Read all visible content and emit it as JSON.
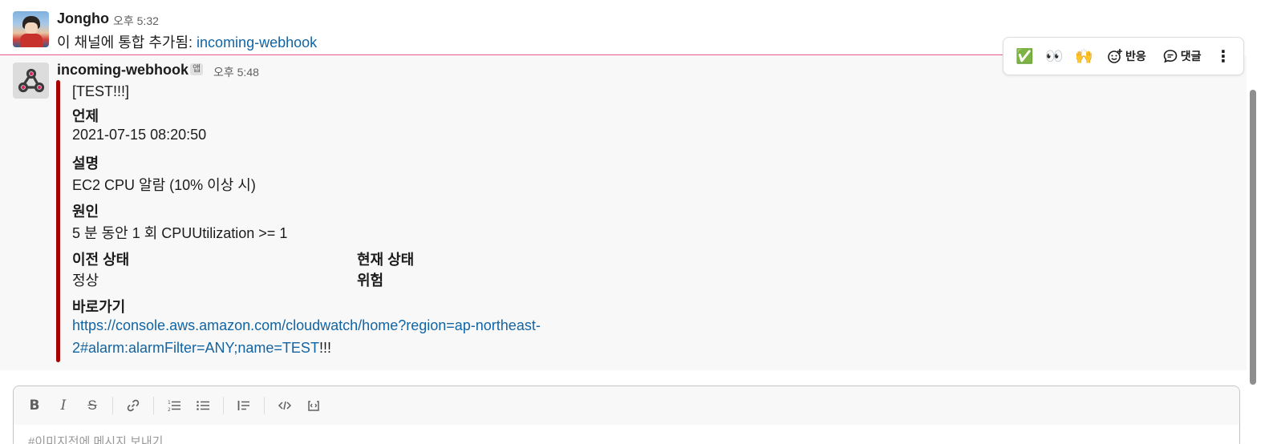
{
  "messages": [
    {
      "author": "Jongho",
      "time": "오후 5:32",
      "text_prefix": "이 채널에 통합 추가됨: ",
      "link_text": "incoming-webhook"
    },
    {
      "author": "incoming-webhook",
      "app_badge": "앱",
      "time": "오후 5:48",
      "attachment": {
        "bar_color": "#a30200",
        "title": "[TEST!!!]",
        "when_label": "언제",
        "when_value": "2021-07-15 08:20:50",
        "desc_label": "설명",
        "desc_value": "EC2 CPU 알람 (10% 이상 시)",
        "cause_label": "원인",
        "cause_value": "5 분 동안 1 회 CPUUtilization >= 1",
        "prev_state_label": "이전 상태",
        "prev_state_value": "정상",
        "curr_state_label": "현재 상태",
        "curr_state_value": "위험",
        "shortcut_label": "바로가기",
        "url_line1": "https://console.aws.amazon.com/cloudwatch/home?region=ap-northeast-",
        "url_line2": "2#alarm:alarmFilter=ANY;name=TEST",
        "url_suffix": "!!!"
      }
    }
  ],
  "hover_toolbar": {
    "emoji_1": "✅",
    "emoji_2": "👀",
    "emoji_3": "🙌",
    "reaction_label": "반응",
    "reply_label": "댓글",
    "more": "⋮"
  },
  "composer": {
    "placeholder": "#이미지전에 메시지 보내기",
    "tools": [
      "B",
      "I",
      "S",
      "link",
      "ordered-list",
      "bulleted-list",
      "blockquote",
      "code",
      "code-block"
    ]
  },
  "colors": {
    "link": "#1264a3",
    "new_line": "#e01e5a",
    "attachment_bar": "#a30200"
  }
}
